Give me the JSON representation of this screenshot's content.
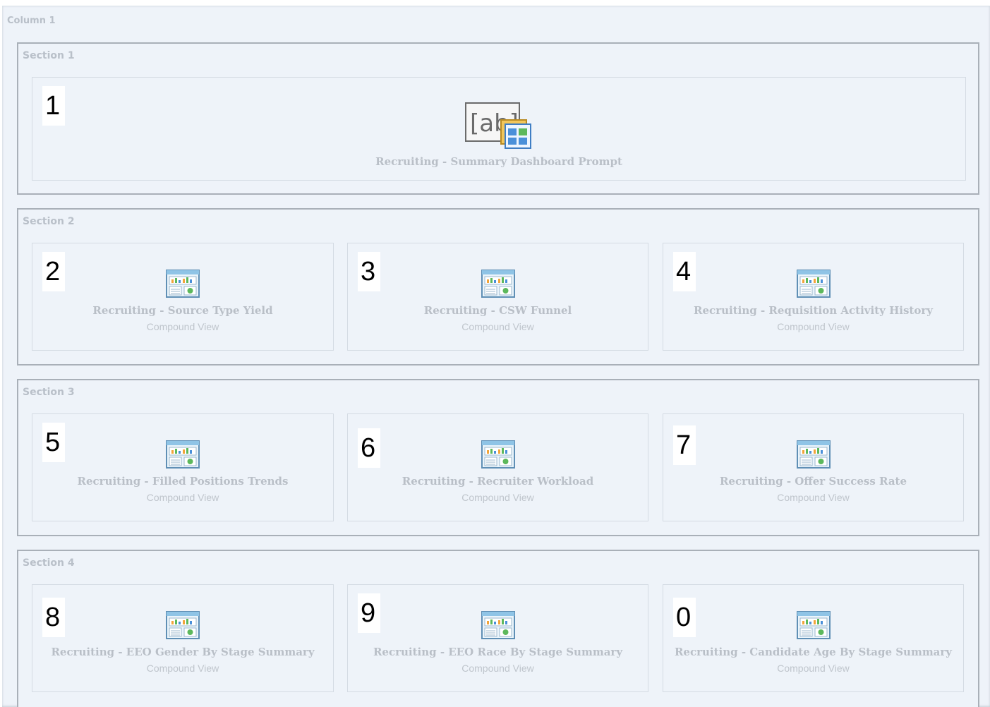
{
  "column": {
    "label": "Column 1"
  },
  "sections": [
    {
      "label": "Section 1",
      "prompt": {
        "badge": "1",
        "icon_text": "[ab]",
        "title": "Recruiting - Summary Dashboard Prompt"
      }
    },
    {
      "label": "Section 2",
      "views": [
        {
          "badge": "2",
          "title": "Recruiting - Source Type Yield",
          "subtitle": "Compound View"
        },
        {
          "badge": "3",
          "title": "Recruiting - CSW Funnel",
          "subtitle": "Compound View"
        },
        {
          "badge": "4",
          "title": "Recruiting - Requisition Activity History",
          "subtitle": "Compound View"
        }
      ]
    },
    {
      "label": "Section 3",
      "views": [
        {
          "badge": "5",
          "title": "Recruiting - Filled Positions Trends",
          "subtitle": "Compound View"
        },
        {
          "badge": "6",
          "title": "Recruiting - Recruiter Workload",
          "subtitle": "Compound View"
        },
        {
          "badge": "7",
          "title": "Recruiting - Offer Success Rate",
          "subtitle": "Compound View"
        }
      ]
    },
    {
      "label": "Section 4",
      "views": [
        {
          "badge": "8",
          "title": "Recruiting - EEO Gender By Stage Summary",
          "subtitle": "Compound View"
        },
        {
          "badge": "9",
          "title": "Recruiting - EEO Race By Stage Summary",
          "subtitle": "Compound View"
        },
        {
          "badge": "0",
          "title": "Recruiting - Candidate Age By Stage Summary",
          "subtitle": "Compound View"
        }
      ]
    }
  ]
}
